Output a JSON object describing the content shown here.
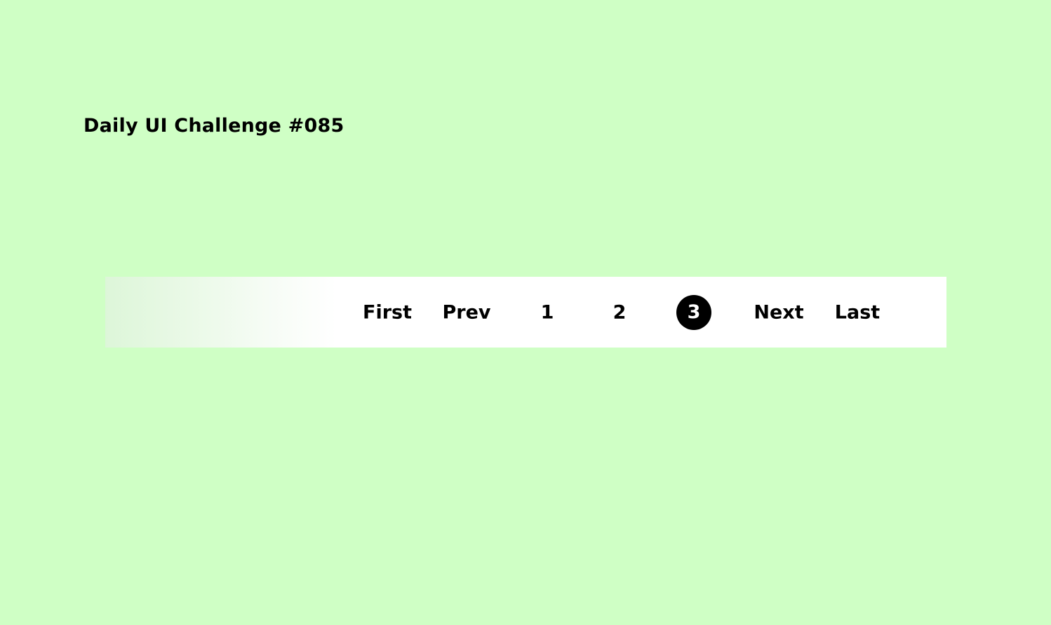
{
  "header": {
    "title": "Daily UI Challenge #085"
  },
  "pagination": {
    "first_label": "First",
    "prev_label": "Prev",
    "pages": [
      "1",
      "2",
      "3"
    ],
    "current_page": "3",
    "next_label": "Next",
    "last_label": "Last"
  },
  "colors": {
    "background": "#CFFFC5",
    "bar_background": "#FFFFFF",
    "current_page_background": "#000000",
    "current_page_text": "#FFFFFF",
    "text": "#000000"
  }
}
